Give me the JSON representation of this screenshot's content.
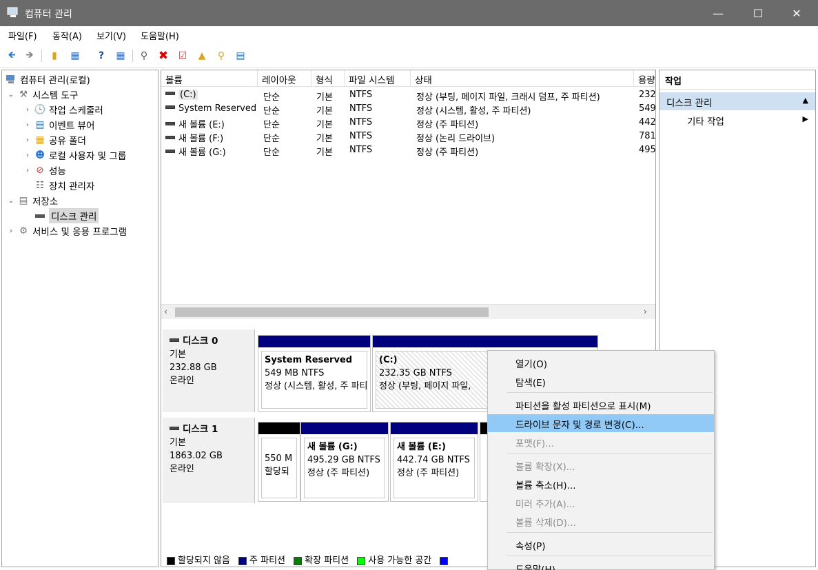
{
  "window": {
    "title": "컴퓨터 관리"
  },
  "menu": [
    "파일(F)",
    "동작(A)",
    "보기(V)",
    "도움말(H)"
  ],
  "tree": {
    "root": "컴퓨터 관리(로컬)",
    "system_tools": "시스템 도구",
    "task_scheduler": "작업 스케줄러",
    "event_viewer": "이벤트 뷰어",
    "shared_folders": "공유 폴더",
    "local_users": "로컬 사용자 및 그룹",
    "performance": "성능",
    "device_manager": "장치 관리자",
    "storage": "저장소",
    "disk_management": "디스크 관리",
    "services": "서비스 및 응용 프로그램"
  },
  "list": {
    "columns": [
      "볼륨",
      "레이아웃",
      "형식",
      "파일 시스템",
      "상태",
      "용량"
    ],
    "rows": [
      {
        "volume": "(C:)",
        "layout": "단순",
        "type": "기본",
        "fs": "NTFS",
        "status": "정상 (부팅, 페이지 파일, 크래시 덤프, 주 파티션)",
        "cap": "232"
      },
      {
        "volume": "System Reserved",
        "layout": "단순",
        "type": "기본",
        "fs": "NTFS",
        "status": "정상 (시스템, 활성, 주 파티션)",
        "cap": "549"
      },
      {
        "volume": "새 볼륨 (E:)",
        "layout": "단순",
        "type": "기본",
        "fs": "NTFS",
        "status": "정상 (주 파티션)",
        "cap": "442"
      },
      {
        "volume": "새 볼륨 (F:)",
        "layout": "단순",
        "type": "기본",
        "fs": "NTFS",
        "status": "정상 (논리 드라이브)",
        "cap": "781"
      },
      {
        "volume": "새 볼륨 (G:)",
        "layout": "단순",
        "type": "기본",
        "fs": "NTFS",
        "status": "정상 (주 파티션)",
        "cap": "495"
      }
    ]
  },
  "disks": [
    {
      "name": "디스크 0",
      "type": "기본",
      "size": "232.88 GB",
      "state": "온라인",
      "parts": [
        {
          "name": "System Reserved",
          "size": "549 MB NTFS",
          "status": "정상 (시스템, 활성, 주 파티션)",
          "color": "#00007f"
        },
        {
          "name": "(C:)",
          "size": "232.35 GB NTFS",
          "status": "정상 (부팅, 페이지 파일,",
          "color": "#00007f"
        }
      ]
    },
    {
      "name": "디스크 1",
      "type": "기본",
      "size": "1863.02 GB",
      "state": "온라인",
      "parts": [
        {
          "name": "",
          "size": "550 M",
          "status": "할당되",
          "color": "#000000"
        },
        {
          "name": "새 볼륨  (G:)",
          "size": "495.29 GB NTFS",
          "status": "정상 (주 파티션)",
          "color": "#00007f"
        },
        {
          "name": "새 볼륨  (E:)",
          "size": "442.74 GB NTFS",
          "status": "정상 (주 파티션)",
          "color": "#00007f"
        }
      ]
    }
  ],
  "legend": [
    {
      "label": "할당되지 않음",
      "color": "#000000"
    },
    {
      "label": "주 파티션",
      "color": "#00007f"
    },
    {
      "label": "확장 파티션",
      "color": "#007f00"
    },
    {
      "label": "사용 가능한 공간",
      "color": "#00ff00"
    },
    {
      "label": "",
      "color": "#0000ff"
    }
  ],
  "actions": {
    "title": "작업",
    "section": "디스크 관리",
    "more": "기타 작업"
  },
  "context_menu": [
    {
      "label": "열기(O)",
      "disabled": false
    },
    {
      "label": "탐색(E)",
      "disabled": false
    },
    {
      "label": "파티션을 활성 파티션으로 표시(M)",
      "disabled": false
    },
    {
      "label": "드라이브 문자 및 경로 변경(C)...",
      "disabled": false,
      "highlighted": true
    },
    {
      "label": "포맷(F)...",
      "disabled": true
    },
    {
      "label": "볼륨 확장(X)...",
      "disabled": true
    },
    {
      "label": "볼륨 축소(H)...",
      "disabled": false
    },
    {
      "label": "미러 추가(A)...",
      "disabled": true
    },
    {
      "label": "볼륨 삭제(D)...",
      "disabled": true
    },
    {
      "label": "속성(P)",
      "disabled": false
    },
    {
      "label": "도움말(H)",
      "disabled": false
    }
  ]
}
